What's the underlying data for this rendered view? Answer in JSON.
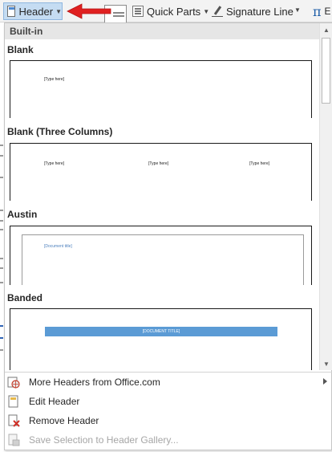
{
  "ribbon": {
    "header_label": "Header",
    "quick_parts_label": "Quick Parts",
    "signature_line_label": "Signature Line",
    "equation_symbol": "π",
    "equation_partial": "E"
  },
  "gallery": {
    "section_label": "Built-in",
    "items": [
      {
        "label": "Blank",
        "placeholders": [
          "[Type here]"
        ]
      },
      {
        "label": "Blank (Three Columns)",
        "placeholders": [
          "[Type here]",
          "[Type here]",
          "[Type here]"
        ]
      },
      {
        "label": "Austin",
        "placeholders": [
          "[Document title]"
        ]
      },
      {
        "label": "Banded",
        "placeholders": [
          "[DOCUMENT TITLE]"
        ]
      }
    ]
  },
  "menu": {
    "more_headers": "More Headers from Office.com",
    "edit_header": "Edit Header",
    "remove_header": "Remove Header",
    "save_selection": "Save Selection to Header Gallery..."
  },
  "colors": {
    "accent_blue": "#5b9bd5",
    "arrow_red": "#e02020",
    "ribbon_selected": "#c5dcf2"
  }
}
